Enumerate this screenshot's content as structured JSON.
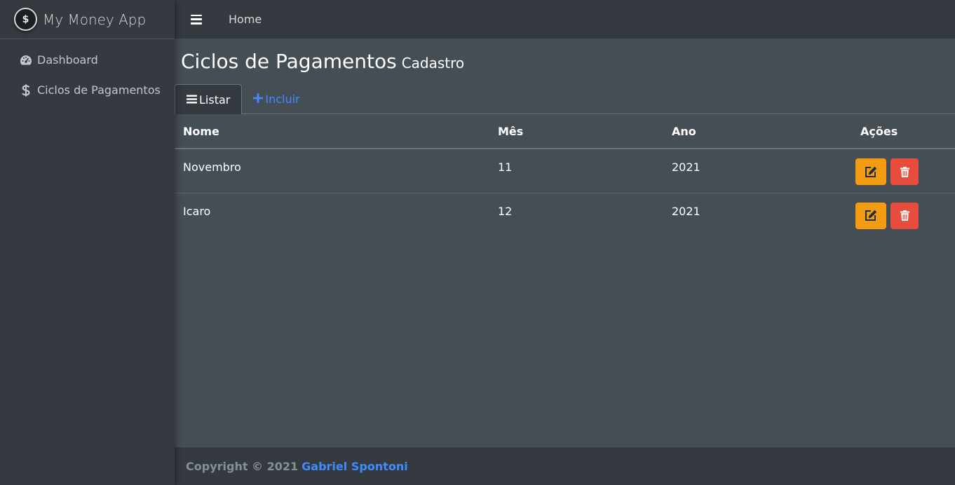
{
  "brand": {
    "logo_text": "$",
    "name": "My Money App"
  },
  "sidebar": {
    "items": [
      {
        "label": "Dashboard",
        "icon": "tachometer-icon"
      },
      {
        "label": "Ciclos de Pagamentos",
        "icon": "dollar-icon"
      }
    ]
  },
  "topbar": {
    "home_label": "Home"
  },
  "page": {
    "title": "Ciclos de Pagamentos",
    "subtitle": "Cadastro"
  },
  "tabs": [
    {
      "label": "Listar",
      "icon": "list-icon",
      "active": true
    },
    {
      "label": "Incluir",
      "icon": "plus-icon",
      "active": false
    }
  ],
  "table": {
    "headers": {
      "nome": "Nome",
      "mes": "Mês",
      "ano": "Ano",
      "acoes": "Ações"
    },
    "rows": [
      {
        "nome": "Novembro",
        "mes": "11",
        "ano": "2021"
      },
      {
        "nome": "Icaro",
        "mes": "12",
        "ano": "2021"
      }
    ]
  },
  "footer": {
    "copyright": "Copyright © 2021",
    "author": "Gabriel Spontoni"
  },
  "colors": {
    "sidebar_bg": "#343a40",
    "content_bg": "#454d55",
    "link": "#3f8cff",
    "edit_button": "#f39c12",
    "delete_button": "#e74c3c"
  }
}
